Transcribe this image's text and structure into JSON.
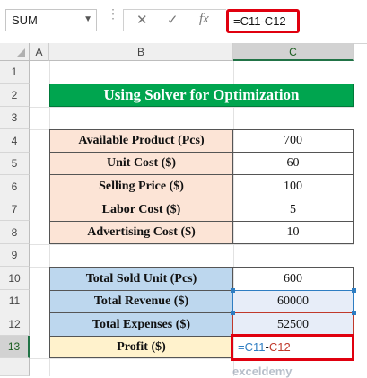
{
  "formula_bar": {
    "name_box": "SUM",
    "cancel_icon": "✕",
    "enter_icon": "✓",
    "fx_label": "fx",
    "formula": "=C11-C12"
  },
  "columns": [
    "A",
    "B",
    "C"
  ],
  "rows": [
    "1",
    "2",
    "3",
    "4",
    "5",
    "6",
    "7",
    "8",
    "9",
    "10",
    "11",
    "12",
    "13"
  ],
  "title": "Using Solver for Optimization",
  "table1": [
    {
      "label": "Available Product (Pcs)",
      "value": "700"
    },
    {
      "label": "Unit Cost ($)",
      "value": "60"
    },
    {
      "label": "Selling Price ($)",
      "value": "100"
    },
    {
      "label": "Labor Cost ($)",
      "value": "5"
    },
    {
      "label": "Advertising Cost ($)",
      "value": "10"
    }
  ],
  "table2": [
    {
      "label": "Total Sold Unit (Pcs)",
      "value": "600"
    },
    {
      "label": "Total Revenue ($)",
      "value": "60000"
    },
    {
      "label": "Total Expenses ($)",
      "value": "52500"
    },
    {
      "label": "Profit ($)",
      "value_part1": "=C11",
      "value_op": "-",
      "value_part2": "C12"
    }
  ],
  "watermark": "exceldemy",
  "colors": {
    "title_bg": "#00a54f",
    "peach": "#fce4d6",
    "blue": "#bdd7ee",
    "yellow": "#fff2cc",
    "highlight": "#e0000f",
    "ref1": "#2e7dc2",
    "ref2": "#c0392b"
  }
}
